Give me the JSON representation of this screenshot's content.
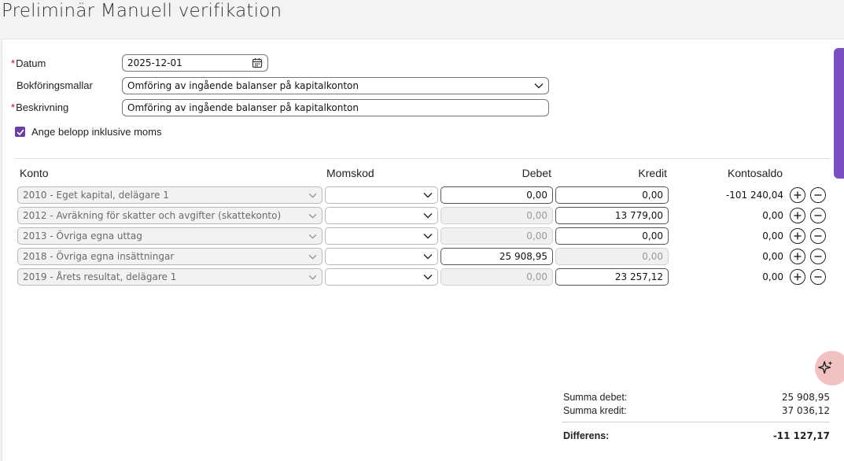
{
  "page": {
    "title": "Preliminär Manuell verifikation"
  },
  "form": {
    "datum": {
      "label": "Datum",
      "value": "2025-12-01"
    },
    "mallar": {
      "label": "Bokföringsmallar",
      "value": "Omföring av ingående balanser på kapitalkonton"
    },
    "beskrivning": {
      "label": "Beskrivning",
      "value": "Omföring av ingående balanser på kapitalkonton"
    },
    "moms_checkbox": {
      "label": "Ange belopp inklusive moms",
      "checked": true
    }
  },
  "table": {
    "headers": {
      "konto": "Konto",
      "momskod": "Momskod",
      "debet": "Debet",
      "kredit": "Kredit",
      "kontosaldo": "Kontosaldo"
    },
    "rows": [
      {
        "konto": "2010 - Eget kapital, delägare 1",
        "debet": "0,00",
        "debet_enabled": true,
        "kredit": "0,00",
        "kredit_enabled": true,
        "saldo": "-101 240,04"
      },
      {
        "konto": "2012 - Avräkning för skatter och avgifter (skattekonto)",
        "debet": "0,00",
        "debet_enabled": false,
        "kredit": "13 779,00",
        "kredit_enabled": true,
        "saldo": "0,00"
      },
      {
        "konto": "2013 - Övriga egna uttag",
        "debet": "0,00",
        "debet_enabled": false,
        "kredit": "0,00",
        "kredit_enabled": true,
        "saldo": "0,00"
      },
      {
        "konto": "2018 - Övriga egna insättningar",
        "debet": "25 908,95",
        "debet_enabled": true,
        "kredit": "0,00",
        "kredit_enabled": false,
        "saldo": "0,00"
      },
      {
        "konto": "2019 - Årets resultat, delägare 1",
        "debet": "0,00",
        "debet_enabled": false,
        "kredit": "23 257,12",
        "kredit_enabled": true,
        "saldo": "0,00"
      }
    ]
  },
  "summary": {
    "debet": {
      "label": "Summa debet:",
      "value": "25 908,95"
    },
    "kredit": {
      "label": "Summa kredit:",
      "value": "37 036,12"
    },
    "differens": {
      "label": "Differens:",
      "value": "-11 127,17"
    }
  },
  "icons": {
    "calendar": "calendar-icon",
    "chevron": "chevron-down-icon",
    "add": "plus-circle-icon",
    "remove": "minus-circle-icon",
    "ai": "sparkle-icon"
  },
  "colors": {
    "accent": "#7a4fc2",
    "required": "#d0021b",
    "checkbox": "#6b3fa0",
    "fab": "#f2c1c1"
  }
}
